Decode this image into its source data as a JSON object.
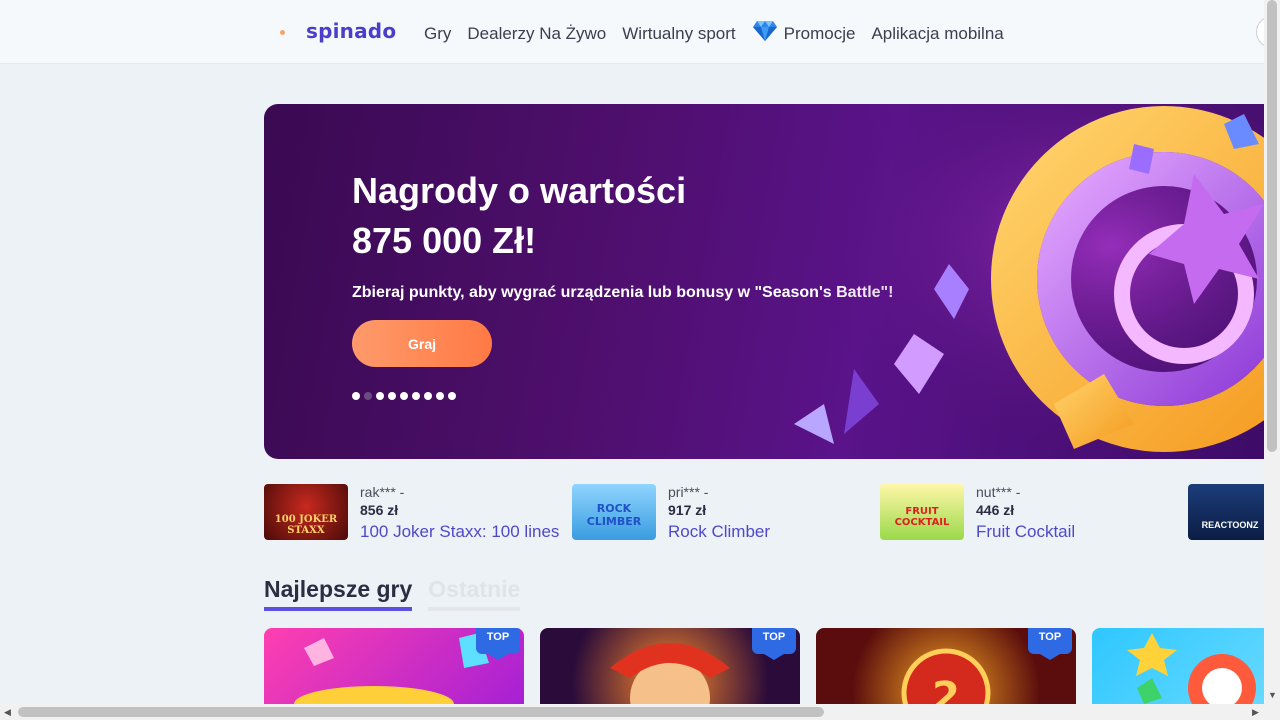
{
  "header": {
    "logo": "spinado",
    "nav": [
      {
        "label": "Gry"
      },
      {
        "label": "Dealerzy Na Żywo"
      },
      {
        "label": "Wirtualny sport"
      },
      {
        "label": "Promocje",
        "icon": "diamond-icon"
      },
      {
        "label": "Aplikacja mobilna"
      }
    ]
  },
  "banner": {
    "title_line1": "Nagrody o wartości",
    "title_line2": "875 000 Zł!",
    "subtitle": "Zbieraj punkty, aby wygrać urządzenia lub bonusy w \"Season's Battle\"!",
    "button_label": "Graj",
    "slides_count": 9,
    "active_slide": 2
  },
  "winners": [
    {
      "user": "rak*** -",
      "amount": "856 zł",
      "game": "100 Joker Staxx: 100 lines",
      "thumb_text": "100 JOKER STAXX"
    },
    {
      "user": "pri*** -",
      "amount": "917 zł",
      "game": "Rock Climber",
      "thumb_text": "ROCK CLIMBER"
    },
    {
      "user": "nut*** -",
      "amount": "446 zł",
      "game": "Fruit Cocktail",
      "thumb_text": "FRUIT COCKTAIL"
    },
    {
      "user": "",
      "amount": "",
      "game": "",
      "thumb_text": "REACTOONZ"
    }
  ],
  "tabs": [
    {
      "label": "Najlepsze gry",
      "active": true
    },
    {
      "label": "Ostatnie",
      "active": false
    }
  ],
  "cards": [
    {
      "badge": "TOP",
      "theme": "pink"
    },
    {
      "badge": "TOP",
      "theme": "joker"
    },
    {
      "badge": "TOP",
      "theme": "red"
    },
    {
      "badge": "",
      "theme": "candy"
    }
  ],
  "colors": {
    "accent": "#4e49c9",
    "button": "#ff7a45",
    "badge": "#2f6ae5",
    "banner_bg": "#4e0f6d"
  }
}
